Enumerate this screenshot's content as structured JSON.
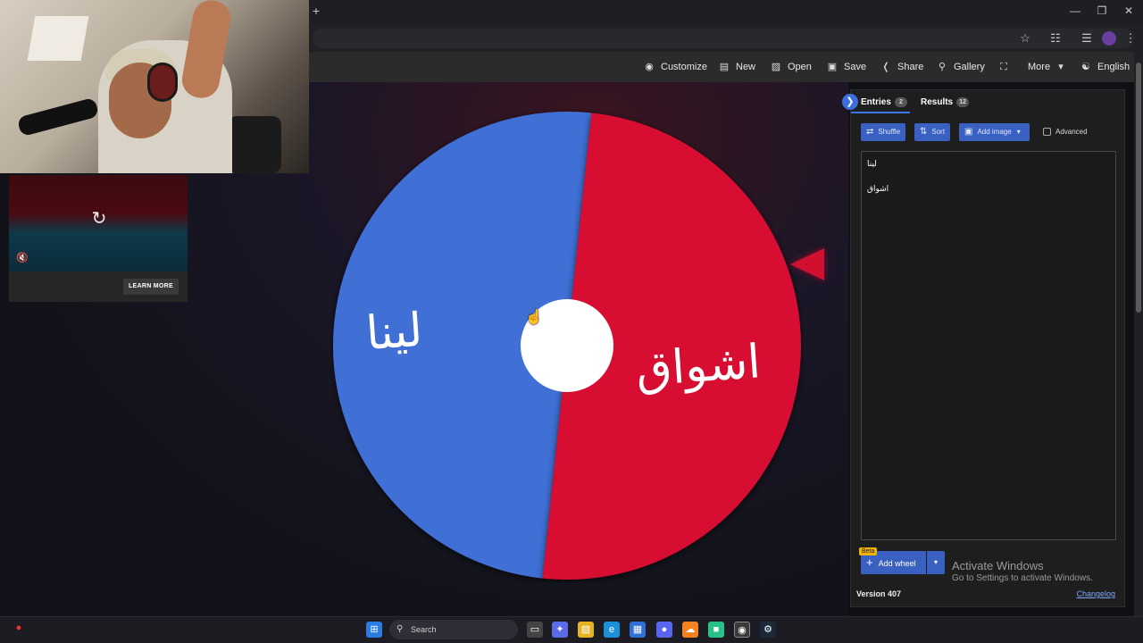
{
  "browser": {
    "new_tab_symbol": "+"
  },
  "appbar": {
    "items": [
      {
        "label": "Customize",
        "icon": "palette-icon"
      },
      {
        "label": "New",
        "icon": "file-icon"
      },
      {
        "label": "Open",
        "icon": "folder-icon"
      },
      {
        "label": "Save",
        "icon": "save-icon"
      },
      {
        "label": "Share",
        "icon": "share-icon"
      },
      {
        "label": "Gallery",
        "icon": "search-icon"
      },
      {
        "label": "",
        "icon": "fullscreen-icon"
      },
      {
        "label": "More",
        "icon": "chevron-down-icon"
      },
      {
        "label": "English",
        "icon": "globe-icon"
      }
    ]
  },
  "ad": {
    "button_label": "LEARN MORE"
  },
  "wheel": {
    "segments": [
      {
        "label": "لينا",
        "color": "#3f6fd6"
      },
      {
        "label": "اشواق",
        "color": "#d70a32"
      }
    ],
    "center_color": "#ffffff",
    "pointer_color": "#d1102f"
  },
  "panel": {
    "tabs": [
      {
        "label": "Entries",
        "count": "2"
      },
      {
        "label": "Results",
        "count": "12"
      }
    ],
    "buttons": {
      "shuffle": "Shuffle",
      "sort": "Sort",
      "add_image": "Add image",
      "advanced": "Advanced"
    },
    "entries": [
      "لينا",
      "اشواق"
    ],
    "beta_badge": "Beta",
    "add_wheel": "Add wheel",
    "version": "Version 407",
    "changelog": "Changelog"
  },
  "watermark": {
    "title": "Activate Windows",
    "subtitle": "Go to Settings to activate Windows."
  },
  "taskbar": {
    "search_label": "Search"
  }
}
